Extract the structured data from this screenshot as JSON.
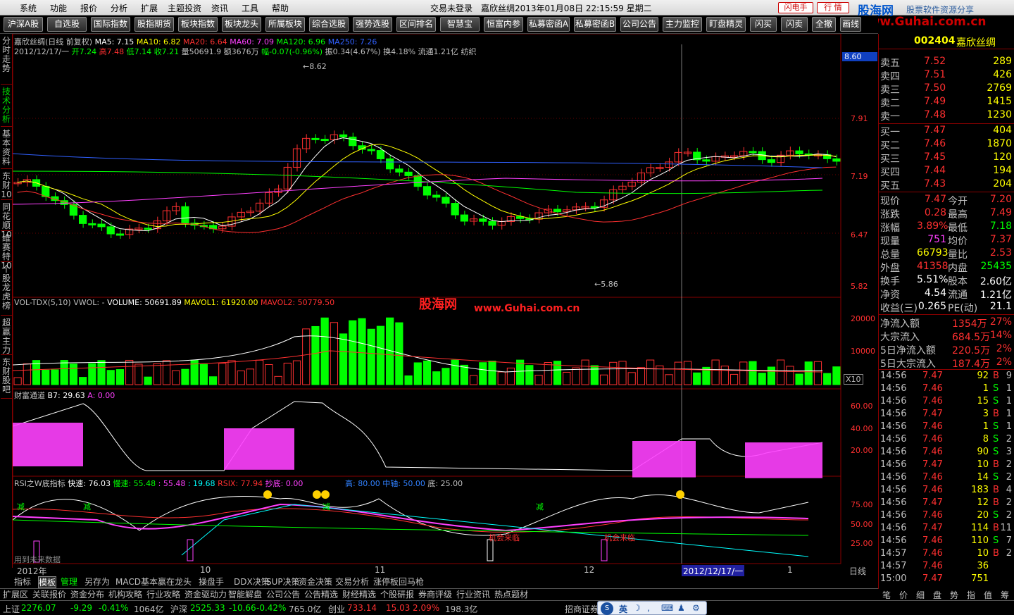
{
  "menu": {
    "items": [
      "系统",
      "功能",
      "报价",
      "分析",
      "扩展",
      "主题投资",
      "资讯",
      "工具",
      "帮助"
    ],
    "title": "交易未登录　嘉欣丝绸2013年01月08日 22:15:59 星期二",
    "flash_btn": "闪电手",
    "quote_btn": "行 情",
    "logo_main": "股海网",
    "logo_sub": "股票软件资源分享",
    "logo_url": "www.Guhai.com.cn"
  },
  "toolbar": [
    "沪深A股",
    "自选股",
    "国际指数",
    "股指期货",
    "板块指数",
    "板块龙头",
    "所属板块",
    "综合选股",
    "强势选股",
    "区间排名",
    "智慧宝",
    "恒富内参",
    "私募密函A",
    "私募密函B",
    "公司公告",
    "主力监控",
    "盯盘精灵",
    "闪买",
    "闪卖",
    "全撤",
    "画线"
  ],
  "leftnav": [
    {
      "label": "分时走势"
    },
    {
      "label": "技术分析",
      "active": true
    },
    {
      "label": "基本资料"
    },
    {
      "label": "东财10"
    },
    {
      "label": "同花顺10"
    },
    {
      "label": "维赛特10"
    },
    {
      "label": "个股龙虎榜"
    },
    {
      "label": "超赢主力"
    },
    {
      "label": "东财股吧"
    }
  ],
  "main_panel": {
    "line1_prefix": "嘉欣丝绸(日线 前复权)",
    "ma5": "MA5: 7.15",
    "ma10": "MA10: 6.82",
    "ma20": "MA20: 6.64",
    "ma60": "MA60: 7.09",
    "ma120": "MA120: 6.96",
    "ma250": "MA250: 7.26",
    "line2_date": "2012/12/17/一",
    "open": "开7.24",
    "high": "高7.48",
    "low": "低7.14",
    "close": "收7.21",
    "vol": "量50691.9",
    "amt": "额3676万",
    "chg": "幅-0.07(-0.96%)",
    "amp": "振0.34(4.67%)",
    "turnover": "换4.18%",
    "float": "流通1.21亿",
    "industry": "纺织",
    "price_tag": "8.60",
    "high_mark": "8.62",
    "low_mark": "5.86",
    "y_ticks": [
      "7.91",
      "7.19",
      "6.47",
      "5.82"
    ],
    "colors": {
      "ma5": "#ffffff",
      "ma10": "#ffff00",
      "ma20": "#ff3030",
      "ma60": "#ff40ff",
      "ma120": "#00ff00",
      "ma250": "#3060ff",
      "up": "#ff3030",
      "down": "#00ff00"
    }
  },
  "vol_panel": {
    "label": "VOL-TDX(5,10)",
    "vwol": "VWOL: -",
    "volume": "VOLUME: 50691.89",
    "mavol1": "MAVOL1: 61920.00",
    "mavol2": "MAVOL2: 50779.50",
    "y_ticks": [
      "20000",
      "10000"
    ],
    "unit": "X10"
  },
  "wealth_panel": {
    "label": "财富通道",
    "b7": "B7: 29.63",
    "a": "A: 0.00",
    "y_ticks": [
      "60.00",
      "40.00",
      "20.00"
    ]
  },
  "rsi_panel": {
    "label": "RSI之W底指标",
    "fast": "快速: 76.03",
    "slow": "慢速: 55.48",
    "v3": ": 55.48",
    "v4": ": 19.68",
    "rsix": "RSIX: 77.94",
    "bottom": "抄底: 0.00",
    "high": "高: 80.00",
    "mid": "中轴: 50.00",
    "low": "底: 25.00",
    "y_ticks": [
      "75.00",
      "50.00",
      "25.00"
    ],
    "reduce": "减",
    "buy": "机会来临",
    "footnote": "用到未来数据"
  },
  "xaxis": {
    "labels": [
      "2012年",
      "10",
      "11",
      "12",
      "2012/12/17/一",
      "1"
    ],
    "period": "日线"
  },
  "bottom_tabs": [
    "指标",
    "模板",
    "管理",
    "另存为",
    "MACD基本",
    "赢在龙头",
    "操盘手",
    "DDX决策",
    "SUP决策",
    "资金决策",
    "交易分析",
    "涨停板回马枪"
  ],
  "bottom_tabs2": [
    "扩展区",
    "关联报价",
    "资金分布",
    "机构攻略",
    "行业攻略",
    "资金驱动力",
    "智能解盘",
    "公司公告",
    "公告精选",
    "财经精选",
    "个股研报",
    "券商评级",
    "行业资讯",
    "热点题材"
  ],
  "status": {
    "sh_label": "上证",
    "sh_val": "2276.07",
    "sh_chg": "-9.29",
    "sh_pct": "-0.41%",
    "sh_amt": "1064亿",
    "sz_label": "沪深",
    "sz_val": "2525.33",
    "sz_chg": "-10.66",
    "sz_pct": "-0.42%",
    "sz_amt": "765.0亿",
    "cy_label": "创业",
    "cy_val": "733.14",
    "cy_chg": "15.03",
    "cy_pct": "2.09%",
    "cy_amt": "198.3亿",
    "broker": "招商证券",
    "ime": "英"
  },
  "right": {
    "code": "002404",
    "name": "嘉欣丝绸",
    "asks": [
      {
        "l": "卖五",
        "p": "7.52",
        "v": "289"
      },
      {
        "l": "卖四",
        "p": "7.51",
        "v": "426"
      },
      {
        "l": "卖三",
        "p": "7.50",
        "v": "2769"
      },
      {
        "l": "卖二",
        "p": "7.49",
        "v": "1415"
      },
      {
        "l": "卖一",
        "p": "7.48",
        "v": "1230"
      }
    ],
    "bids": [
      {
        "l": "买一",
        "p": "7.47",
        "v": "404"
      },
      {
        "l": "买二",
        "p": "7.46",
        "v": "1870"
      },
      {
        "l": "买三",
        "p": "7.45",
        "v": "120"
      },
      {
        "l": "买四",
        "p": "7.44",
        "v": "194"
      },
      {
        "l": "买五",
        "p": "7.43",
        "v": "204"
      }
    ],
    "stats": [
      [
        "现价",
        "7.47",
        "今开",
        "7.20"
      ],
      [
        "涨跌",
        "0.28",
        "最高",
        "7.49"
      ],
      [
        "涨幅",
        "3.89%",
        "最低",
        "7.18"
      ],
      [
        "现量",
        "751",
        "均价",
        "7.37"
      ],
      [
        "总量",
        "66793",
        "量比",
        "2.53"
      ],
      [
        "外盘",
        "41358",
        "内盘",
        "25435"
      ],
      [
        "换手",
        "5.51%",
        "股本",
        "2.60亿"
      ],
      [
        "净资",
        "4.54",
        "流通",
        "1.21亿"
      ],
      [
        "收益(三)",
        "0.265",
        "PE(动)",
        "21.1"
      ]
    ],
    "flows": [
      [
        "净流入额",
        "1354万",
        "27%"
      ],
      [
        "大宗流入",
        "684.5万",
        "14%"
      ],
      [
        "5日净流入额",
        "220.5万",
        "2%"
      ],
      [
        "5日大宗流入",
        "187.4万",
        "2%"
      ]
    ],
    "ticks": [
      [
        "14:56",
        "7.47",
        "92",
        "B",
        "9"
      ],
      [
        "14:56",
        "7.46",
        "1",
        "S",
        "1"
      ],
      [
        "14:56",
        "7.46",
        "15",
        "S",
        "1"
      ],
      [
        "14:56",
        "7.47",
        "3",
        "B",
        "1"
      ],
      [
        "14:56",
        "7.46",
        "1",
        "S",
        "1"
      ],
      [
        "14:56",
        "7.46",
        "8",
        "S",
        "2"
      ],
      [
        "14:56",
        "7.46",
        "90",
        "S",
        "3"
      ],
      [
        "14:56",
        "7.47",
        "10",
        "B",
        "2"
      ],
      [
        "14:56",
        "7.46",
        "14",
        "S",
        "2"
      ],
      [
        "14:56",
        "7.46",
        "183",
        "B",
        "4"
      ],
      [
        "14:56",
        "7.47",
        "12",
        "B",
        "2"
      ],
      [
        "14:56",
        "7.46",
        "20",
        "S",
        "2"
      ],
      [
        "14:56",
        "7.47",
        "114",
        "B",
        "11"
      ],
      [
        "14:56",
        "7.46",
        "110",
        "S",
        "7"
      ],
      [
        "14:57",
        "7.46",
        "10",
        "B",
        "2"
      ],
      [
        "14:57",
        "7.46",
        "36",
        "",
        ""
      ],
      [
        "15:00",
        "7.47",
        "751",
        "",
        ""
      ]
    ],
    "tabs": [
      "笔",
      "价",
      "细",
      "盘",
      "势",
      "指",
      "值",
      "筹"
    ]
  },
  "watermark": {
    "cn": "股海网",
    "url": "www.Guhai.com.cn"
  }
}
